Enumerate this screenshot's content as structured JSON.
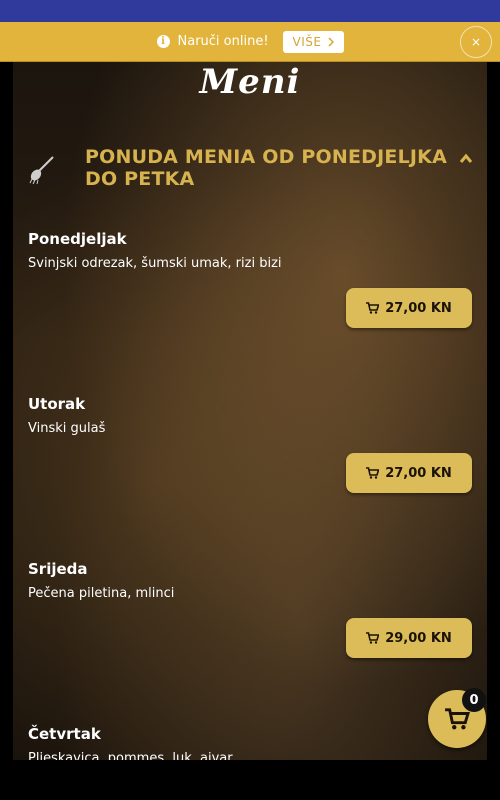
{
  "banner": {
    "text": "Naruči online!",
    "button_label": "VIŠE",
    "close_label": "×"
  },
  "header": {
    "logo": "Meni"
  },
  "section": {
    "title": "PONUDA MENIA OD PONEDJELJKA DO PETKA"
  },
  "items": [
    {
      "day": "Ponedjeljak",
      "description": "Svinjski odrezak, šumski umak, rizi bizi",
      "price": "27,00 KN"
    },
    {
      "day": "Utorak",
      "description": "Vinski gulaš",
      "price": "27,00 KN"
    },
    {
      "day": "Srijeda",
      "description": "Pečena piletina, mlinci",
      "price": "29,00 KN"
    },
    {
      "day": "Četvrtak",
      "description": "Pljeskavica, pommes, luk, ajvar",
      "price": ""
    }
  ],
  "cart": {
    "count": "0"
  },
  "colors": {
    "accent": "#dcbc58",
    "banner": "#e2b43b",
    "title": "#d7b34f"
  },
  "icons": [
    "info-icon",
    "chevron-right-icon",
    "close-icon",
    "spoon-icon",
    "chevron-up-icon",
    "cart-icon"
  ]
}
